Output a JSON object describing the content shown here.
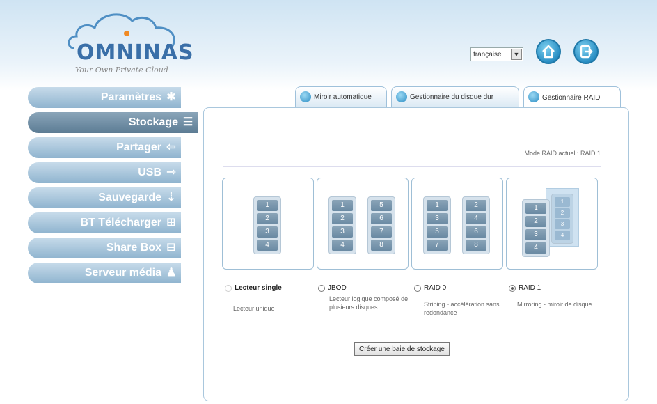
{
  "header": {
    "brand": "OMNINAS",
    "tagline": "Your Own Private Cloud",
    "language": "française",
    "home_icon": "home-icon",
    "exit_icon": "exit-icon"
  },
  "sidebar": {
    "items": [
      {
        "label": "Paramètres",
        "icon": "gear-icon"
      },
      {
        "label": "Stockage",
        "icon": "storage-icon"
      },
      {
        "label": "Partager",
        "icon": "share-arrow-icon"
      },
      {
        "label": "USB",
        "icon": "usb-icon"
      },
      {
        "label": "Sauvegarde",
        "icon": "backup-icon"
      },
      {
        "label": "BT Télécharger",
        "icon": "bt-download-icon"
      },
      {
        "label": "Share Box",
        "icon": "share-box-icon"
      },
      {
        "label": "Serveur média",
        "icon": "media-server-icon"
      }
    ],
    "active": "Stockage"
  },
  "tabs": [
    {
      "label": "Miroir automatique"
    },
    {
      "label": "Gestionnaire du disque dur"
    },
    {
      "label": "Gestionnaire RAID"
    }
  ],
  "raid": {
    "current_label": "Mode RAID actuel : RAID 1",
    "options": [
      {
        "title": "Lecteur single",
        "desc": "Lecteur unique",
        "disks": [
          [
            1,
            2,
            3,
            4
          ]
        ]
      },
      {
        "title": "JBOD",
        "desc": "Lecteur logique composé de plusieurs disques",
        "disks": [
          [
            1,
            2,
            3,
            4
          ],
          [
            5,
            6,
            7,
            8
          ]
        ]
      },
      {
        "title": "RAID 0",
        "desc": "Striping - accélération sans redondance",
        "disks": [
          [
            1,
            3,
            5,
            7
          ],
          [
            2,
            4,
            6,
            8
          ]
        ]
      },
      {
        "title": "RAID 1",
        "desc": "Mirroring - miroir de disque",
        "disks": [
          [
            1,
            2,
            3,
            4
          ]
        ],
        "mirror": [
          1,
          2,
          3,
          4
        ]
      }
    ],
    "selected": "RAID 1",
    "create_button": "Créer une baie de stockage"
  }
}
